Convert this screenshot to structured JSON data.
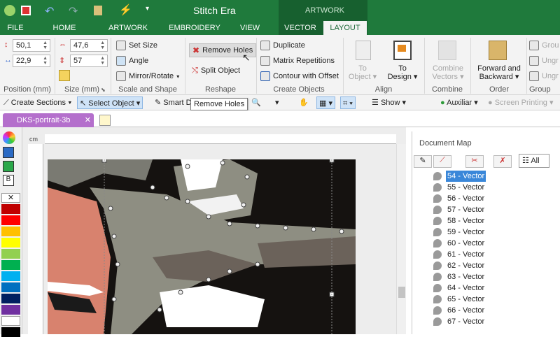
{
  "app": {
    "title": "Stitch Era",
    "context_group": "ARTWORK",
    "tabs": [
      "FILE",
      "HOME",
      "ARTWORK",
      "EMBROIDERY",
      "VIEW",
      "VECTOR",
      "LAYOUT"
    ],
    "active_tab": "LAYOUT"
  },
  "ribbon": {
    "position": {
      "x": "50,1",
      "y": "22,9",
      "label": "Position (mm)"
    },
    "size": {
      "w": "47,6",
      "h": "57",
      "label": "Size (mm)"
    },
    "scale": {
      "set_size": "Set Size",
      "angle": "Angle",
      "mirror_rotate": "Mirror/Rotate",
      "label": "Scale and Shape"
    },
    "reshape": {
      "remove_holes": "Remove Holes",
      "split_object": "Split Object",
      "label": "Reshape"
    },
    "create": {
      "duplicate": "Duplicate",
      "matrix": "Matrix Repetitions",
      "contour": "Contour with Offset",
      "label": "Create Objects"
    },
    "align": {
      "to_object": "To Object",
      "to_design": "To Design",
      "label": "Align"
    },
    "combine": {
      "vectors": "Combine Vectors",
      "label": "Combine"
    },
    "order": {
      "forward_backward": "Forward and Backward",
      "label": "Order"
    },
    "group": {
      "g1": "Grou",
      "g2": "Ungr",
      "g3": "Ungr",
      "label": "Group"
    }
  },
  "toolbar2": {
    "create_sections": "Create Sections",
    "select_object": "Select Object",
    "smart": "Smart D",
    "tooltip": "Remove Holes",
    "show": "Show",
    "auxiliar": "Auxiliar",
    "screen_printing": "Screen Printing"
  },
  "doc": {
    "tab": "DKS-portrait-3b",
    "ruler_unit": "cm"
  },
  "palette": {
    "colors": [
      "#c00000",
      "#ff0000",
      "#ffc000",
      "#ffff00",
      "#92d050",
      "#00b050",
      "#00b0f0",
      "#0070c0",
      "#002060",
      "#7030a0",
      "#ffffff",
      "#000000"
    ]
  },
  "docmap": {
    "title": "Document Map",
    "all_tab": "All",
    "items": [
      "54 - Vector",
      "55 - Vector",
      "56 - Vector",
      "57 - Vector",
      "58 - Vector",
      "59 - Vector",
      "60 - Vector",
      "61 - Vector",
      "62 - Vector",
      "63 - Vector",
      "64 - Vector",
      "65 - Vector",
      "66 - Vector",
      "67 - Vector"
    ],
    "selected": "54 - Vector"
  }
}
